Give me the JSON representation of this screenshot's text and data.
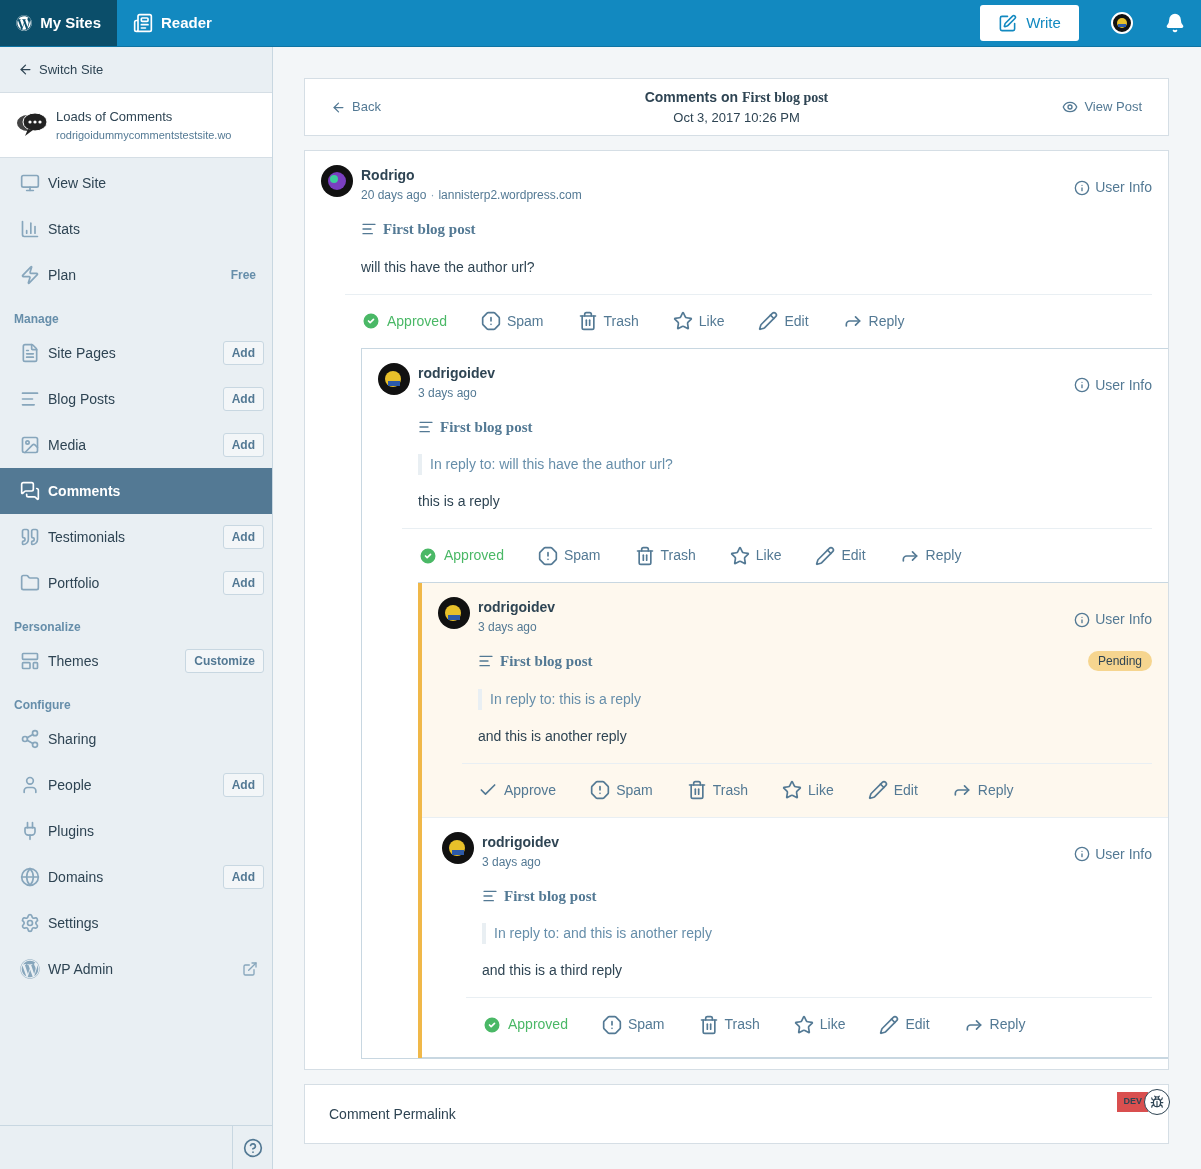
{
  "masterbar": {
    "tabs": [
      {
        "label": "My Sites",
        "selected": true
      },
      {
        "label": "Reader",
        "selected": false
      }
    ],
    "write": "Write"
  },
  "sidebar": {
    "switch_site": "Switch Site",
    "site": {
      "name": "Loads of Comments",
      "url": "rodrigoidummycommentstestsite.wo"
    },
    "top_items": [
      {
        "label": "View Site",
        "selected": false
      },
      {
        "label": "Stats",
        "selected": false
      },
      {
        "label": "Plan",
        "badge": "Free",
        "selected": false
      }
    ],
    "sections": [
      {
        "heading": "Manage",
        "items": [
          {
            "label": "Site Pages",
            "button": "Add",
            "selected": false
          },
          {
            "label": "Blog Posts",
            "button": "Add",
            "selected": false
          },
          {
            "label": "Media",
            "button": "Add",
            "selected": false
          },
          {
            "label": "Comments",
            "selected": true
          },
          {
            "label": "Testimonials",
            "button": "Add",
            "selected": false
          },
          {
            "label": "Portfolio",
            "button": "Add",
            "selected": false
          }
        ]
      },
      {
        "heading": "Personalize",
        "items": [
          {
            "label": "Themes",
            "button": "Customize",
            "selected": false
          }
        ]
      },
      {
        "heading": "Configure",
        "items": [
          {
            "label": "Sharing",
            "selected": false
          },
          {
            "label": "People",
            "button": "Add",
            "selected": false
          },
          {
            "label": "Plugins",
            "selected": false
          },
          {
            "label": "Domains",
            "button": "Add",
            "selected": false
          },
          {
            "label": "Settings",
            "selected": false
          },
          {
            "label": "WP Admin",
            "external": true,
            "selected": false
          }
        ]
      }
    ]
  },
  "header": {
    "back": "Back",
    "title_prefix": "Comments on",
    "post_title": "First blog post",
    "date": "Oct 3, 2017 10:26 PM",
    "view_post": "View Post"
  },
  "comments": [
    {
      "author": "Rodrigo",
      "time": "20 days ago",
      "separator": "·",
      "url": "lannisterp2.wordpress.com",
      "user_info": "User Info",
      "post": "First blog post",
      "text": "will this have the author url?",
      "approved": true,
      "actions": [
        {
          "kind": "approve",
          "label": "Approved"
        },
        {
          "kind": "spam",
          "label": "Spam"
        },
        {
          "kind": "trash",
          "label": "Trash"
        },
        {
          "kind": "like",
          "label": "Like"
        },
        {
          "kind": "edit",
          "label": "Edit"
        },
        {
          "kind": "reply",
          "label": "Reply"
        }
      ],
      "children": [
        {
          "author": "rodrigoidev",
          "time": "3 days ago",
          "user_info": "User Info",
          "post": "First blog post",
          "in_reply_to": "In reply to: will this have the author url?",
          "text": "this is a reply",
          "approved": true,
          "actions": [
            {
              "kind": "approve",
              "label": "Approved"
            },
            {
              "kind": "spam",
              "label": "Spam"
            },
            {
              "kind": "trash",
              "label": "Trash"
            },
            {
              "kind": "like",
              "label": "Like"
            },
            {
              "kind": "edit",
              "label": "Edit"
            },
            {
              "kind": "reply",
              "label": "Reply"
            }
          ],
          "children": [
            {
              "author": "rodrigoidev",
              "time": "3 days ago",
              "user_info": "User Info",
              "post": "First blog post",
              "badge": "Pending",
              "in_reply_to": "In reply to: this is a reply",
              "text": "and this is another reply",
              "approved": false,
              "actions": [
                {
                  "kind": "approve",
                  "label": "Approve"
                },
                {
                  "kind": "spam",
                  "label": "Spam"
                },
                {
                  "kind": "trash",
                  "label": "Trash"
                },
                {
                  "kind": "like",
                  "label": "Like"
                },
                {
                  "kind": "edit",
                  "label": "Edit"
                },
                {
                  "kind": "reply",
                  "label": "Reply"
                }
              ],
              "children": [
                {
                  "author": "rodrigoidev",
                  "time": "3 days ago",
                  "user_info": "User Info",
                  "post": "First blog post",
                  "in_reply_to": "In reply to: and this is another reply",
                  "text": "and this is a third reply",
                  "approved": true,
                  "actions": [
                    {
                      "kind": "approve",
                      "label": "Approved"
                    },
                    {
                      "kind": "spam",
                      "label": "Spam"
                    },
                    {
                      "kind": "trash",
                      "label": "Trash"
                    },
                    {
                      "kind": "like",
                      "label": "Like"
                    },
                    {
                      "kind": "edit",
                      "label": "Edit"
                    },
                    {
                      "kind": "reply",
                      "label": "Reply"
                    }
                  ]
                }
              ]
            }
          ]
        }
      ]
    }
  ],
  "permalink": "Comment Permalink",
  "dev_badge": "DEV"
}
